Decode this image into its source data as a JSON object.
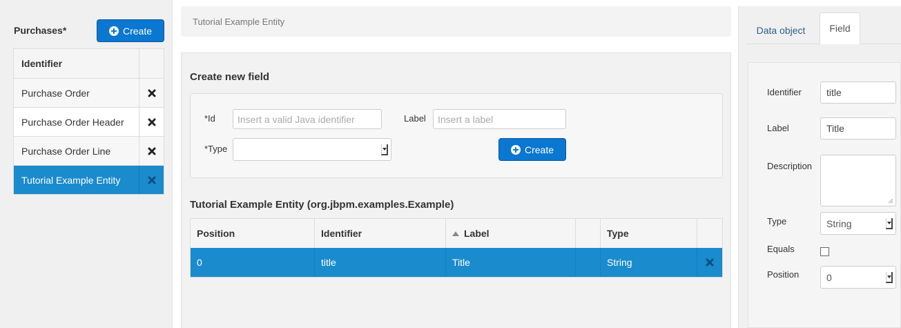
{
  "left": {
    "title": "Purchases*",
    "create_label": "Create",
    "list_header": "Identifier",
    "items": [
      {
        "name": "Purchase Order"
      },
      {
        "name": "Purchase Order Header"
      },
      {
        "name": "Purchase Order Line"
      },
      {
        "name": "Tutorial Example Entity",
        "selected": true
      }
    ]
  },
  "breadcrumb": "Tutorial Example Entity",
  "form": {
    "heading": "Create new field",
    "id_label": "*Id",
    "id_placeholder": "Insert a valid Java identifier",
    "label_label": "Label",
    "label_placeholder": "Insert a label",
    "type_label": "*Type",
    "type_value": "",
    "create_label": "Create"
  },
  "table": {
    "heading": "Tutorial Example Entity (org.jbpm.examples.Example)",
    "columns": [
      "Position",
      "Identifier",
      "Label",
      "",
      "Type",
      ""
    ],
    "sorted_column": "Label",
    "rows": [
      {
        "position": "0",
        "identifier": "title",
        "label": "Title",
        "type": "String"
      }
    ]
  },
  "right": {
    "tabs": [
      "Data object",
      "Field"
    ],
    "active_tab": "Field",
    "identifier_label": "Identifier",
    "identifier_value": "title",
    "label_label": "Label",
    "label_value": "Title",
    "description_label": "Description",
    "description_value": "",
    "type_label": "Type",
    "type_value": "String",
    "equals_label": "Equals",
    "equals_checked": false,
    "position_label": "Position",
    "position_value": "0"
  },
  "colors": {
    "primary": "#0a77d0",
    "selected_row": "#1a8bcd",
    "panel_bg": "#f0f0f0"
  },
  "icons": [
    "plus-circle-icon",
    "close-x-icon",
    "sort-up-icon",
    "dropdown-caret-icon",
    "resize-grip-icon"
  ]
}
